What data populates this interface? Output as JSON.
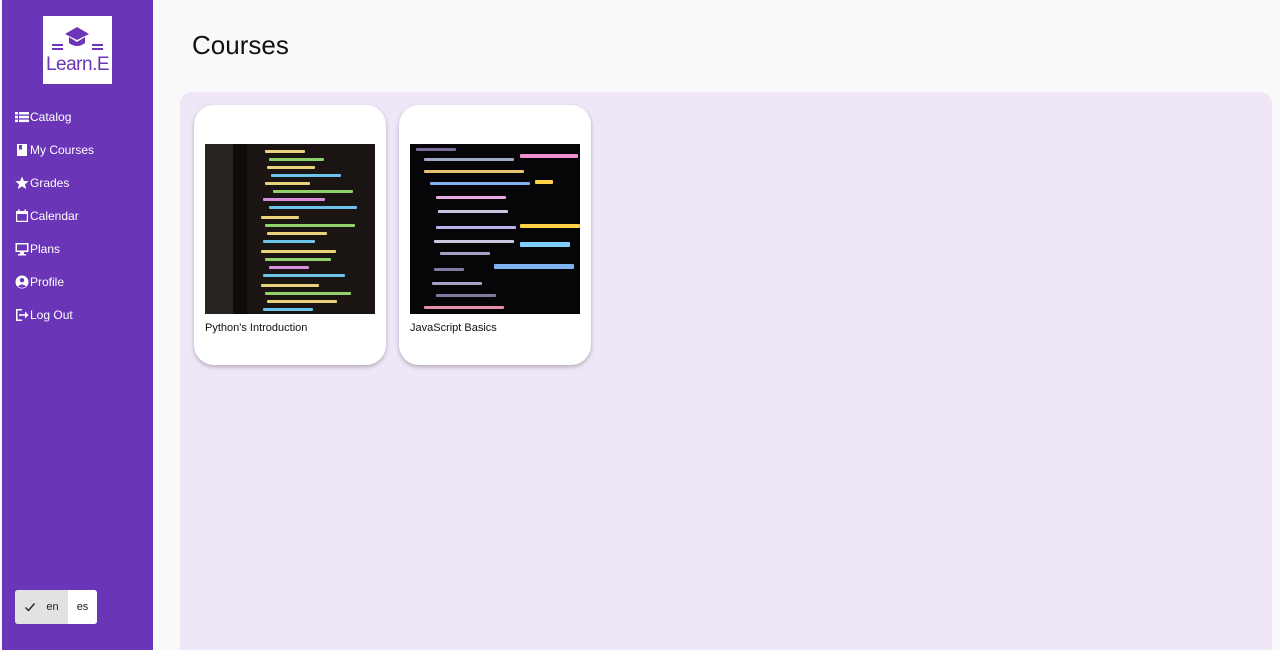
{
  "brand": {
    "logo_text": "Learn.E",
    "accent": "#6a35b7"
  },
  "sidebar": {
    "items": [
      {
        "label": "Catalog",
        "icon": "list-icon"
      },
      {
        "label": "My Courses",
        "icon": "book-icon"
      },
      {
        "label": "Grades",
        "icon": "star-icon"
      },
      {
        "label": "Calendar",
        "icon": "calendar-icon"
      },
      {
        "label": "Plans",
        "icon": "monitor-icon"
      },
      {
        "label": "Profile",
        "icon": "user-circle-icon"
      },
      {
        "label": "Log Out",
        "icon": "logout-icon"
      }
    ],
    "languages": {
      "selected": "en",
      "en": "en",
      "es": "es"
    }
  },
  "main": {
    "title": "Courses",
    "courses": [
      {
        "title": "Python's Introduction",
        "image": "python-code-image"
      },
      {
        "title": "JavaScript Basics",
        "image": "javascript-code-image"
      }
    ]
  }
}
